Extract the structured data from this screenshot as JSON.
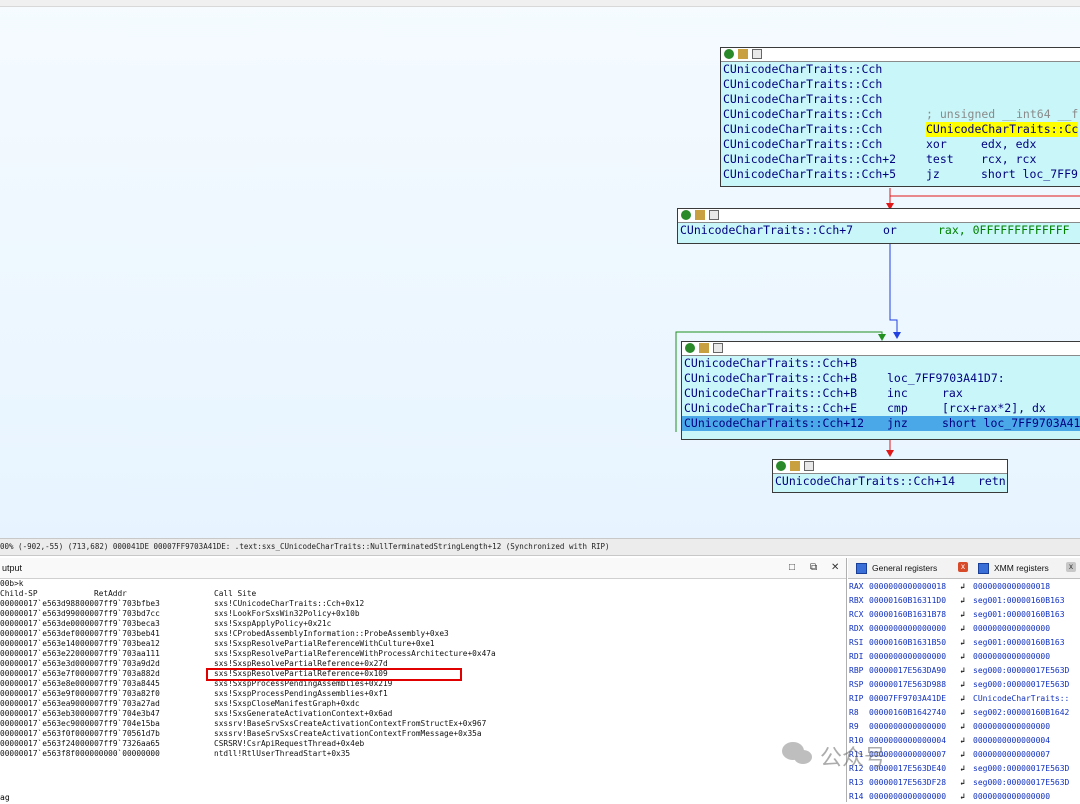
{
  "graph": {
    "node1": {
      "lines": [
        {
          "label": "CUnicodeCharTraits::Cch",
          "instr": "",
          "ops": ""
        },
        {
          "label": "CUnicodeCharTraits::Cch",
          "instr": "",
          "ops": ""
        },
        {
          "label": "CUnicodeCharTraits::Cch",
          "instr": "",
          "ops": ""
        },
        {
          "label": "CUnicodeCharTraits::Cch",
          "instr": "; unsigned __int64 __f",
          "ops": ""
        },
        {
          "label": "CUnicodeCharTraits::Cch",
          "instr": "CUnicodeCharTraits::Cc",
          "ops": ""
        },
        {
          "label": "CUnicodeCharTraits::Cch",
          "instr": "xor",
          "ops": "edx, edx"
        },
        {
          "label": "CUnicodeCharTraits::Cch+2",
          "instr": "test",
          "ops": "rcx, rcx"
        },
        {
          "label": "CUnicodeCharTraits::Cch+5",
          "instr": "jz",
          "ops": "short loc_7FF9"
        }
      ]
    },
    "node2": {
      "label": "CUnicodeCharTraits::Cch+7",
      "instr": "or",
      "ops": "rax, 0FFFFFFFFFFFFF"
    },
    "node3": {
      "lines": [
        {
          "label": "CUnicodeCharTraits::Cch+B",
          "instr": "",
          "ops": ""
        },
        {
          "label": "CUnicodeCharTraits::Cch+B",
          "instr": "loc_7FF9703A41D7:",
          "ops": ""
        },
        {
          "label": "CUnicodeCharTraits::Cch+B",
          "instr": "inc",
          "ops": "rax"
        },
        {
          "label": "CUnicodeCharTraits::Cch+E",
          "instr": "cmp",
          "ops": "[rcx+rax*2], dx"
        },
        {
          "label": "CUnicodeCharTraits::Cch+12",
          "instr": "jnz",
          "ops": "short loc_7FF9703A41"
        }
      ]
    },
    "node4": {
      "label": "CUnicodeCharTraits::Cch+14",
      "instr": "retn"
    }
  },
  "status_bar": "00% (-902,-55) (713,682) 000041DE 00007FF9703A41DE: .text:sxs_CUnicodeCharTraits::NullTerminatedStringLength+12 (Synchronized with RIP)",
  "output": {
    "title": "utput",
    "prompt": "00b>k",
    "columns": [
      "Child-SP",
      "RetAddr",
      "Call Site"
    ],
    "rows": [
      [
        "00000017`e563d988",
        "00007ff9`703bfbe3",
        "sxs!CUnicodeCharTraits::Cch+0x12"
      ],
      [
        "00000017`e563d990",
        "00007ff9`703bd7cc",
        "sxs!LookForSxsWin32Policy+0x10b"
      ],
      [
        "00000017`e563de00",
        "00007ff9`703beca3",
        "sxs!SxspApplyPolicy+0x21c"
      ],
      [
        "00000017`e563def0",
        "00007ff9`703beb41",
        "sxs!CProbedAssemblyInformation::ProbeAssembly+0xe3"
      ],
      [
        "00000017`e563e140",
        "00007ff9`703bea12",
        "sxs!SxspResolvePartialReferenceWithCulture+0xe1"
      ],
      [
        "00000017`e563e220",
        "00007ff9`703aa111",
        "sxs!SxspResolvePartialReferenceWithProcessArchitecture+0x47a"
      ],
      [
        "00000017`e563e3d0",
        "00007ff9`703a9d2d",
        "sxs!SxspResolvePartialReference+0x27d"
      ],
      [
        "00000017`e563e7f0",
        "00007ff9`703a882d",
        "sxs!SxspResolvePartialReference+0x109"
      ],
      [
        "00000017`e563e8e0",
        "00007ff9`703a8445",
        "sxs!SxspProcessPendingAssemblies+0x219"
      ],
      [
        "00000017`e563e9f0",
        "00007ff9`703a82f0",
        "sxs!SxspProcessPendingAssemblies+0xf1"
      ],
      [
        "00000017`e563ea90",
        "00007ff9`703a27ad",
        "sxs!SxspCloseManifestGraph+0xdc"
      ],
      [
        "00000017`e563eb30",
        "00007ff9`704e3b47",
        "sxs!SxsGenerateActivationContext+0x6ad"
      ],
      [
        "00000017`e563ec90",
        "00007ff9`704e15ba",
        "sxssrv!BaseSrvSxsCreateActivationContextFromStructEx+0x967"
      ],
      [
        "00000017`e563f0f0",
        "00007ff9`70561d7b",
        "sxssrv!BaseSrvSxsCreateActivationContextFromMessage+0x35a"
      ],
      [
        "00000017`e563f240",
        "00007ff9`7326aa65",
        "CSRSRV!CsrApiRequestThread+0x4eb"
      ],
      [
        "00000017`e563f8f0",
        "00000000`00000000",
        "ntdll!RtlUserThreadStart+0x35"
      ]
    ],
    "footer": "ag"
  },
  "registers": {
    "tab_general": "General registers",
    "tab_xmm": "XMM registers",
    "rows": [
      {
        "name": "RAX",
        "value": "0000000000000018",
        "ref": "0000000000000018"
      },
      {
        "name": "RBX",
        "value": "00000160B16311D0",
        "ref": "seg001:00000160B163"
      },
      {
        "name": "RCX",
        "value": "00000160B1631B78",
        "ref": "seg001:00000160B163"
      },
      {
        "name": "RDX",
        "value": "0000000000000000",
        "ref": "0000000000000000"
      },
      {
        "name": "RSI",
        "value": "00000160B1631B50",
        "ref": "seg001:00000160B163"
      },
      {
        "name": "RDI",
        "value": "0000000000000000",
        "ref": "0000000000000000"
      },
      {
        "name": "RBP",
        "value": "00000017E563DA90",
        "ref": "seg000:00000017E563D"
      },
      {
        "name": "RSP",
        "value": "00000017E563D988",
        "ref": "seg000:00000017E563D"
      },
      {
        "name": "RIP",
        "value": "00007FF9703A41DE",
        "ref": "CUnicodeCharTraits::"
      },
      {
        "name": "R8",
        "value": "00000160B1642740",
        "ref": "seg002:00000160B1642"
      },
      {
        "name": "R9",
        "value": "0000000000000000",
        "ref": "0000000000000000"
      },
      {
        "name": "R10",
        "value": "0000000000000004",
        "ref": "0000000000000004"
      },
      {
        "name": "R11",
        "value": "0000000000000007",
        "ref": "0000000000000007"
      },
      {
        "name": "R12",
        "value": "00000017E563DE40",
        "ref": "seg000:00000017E563D"
      },
      {
        "name": "R13",
        "value": "00000017E563DF28",
        "ref": "seg000:00000017E563D"
      },
      {
        "name": "R14",
        "value": "0000000000000000",
        "ref": "0000000000000000"
      }
    ]
  },
  "watermark": "公众号"
}
